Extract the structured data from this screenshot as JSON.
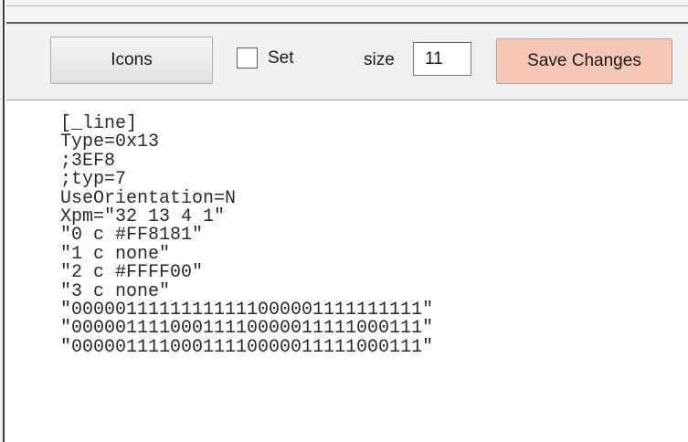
{
  "toolbar": {
    "icons_label": "Icons",
    "set_label": "Set",
    "set_checked": false,
    "size_label": "size",
    "size_value": "11",
    "save_label": "Save Changes",
    "save_color": "#f7c7b6"
  },
  "editor": {
    "lines": [
      "[_line]",
      "Type=0x13",
      ";3EF8",
      ";typ=7",
      "UseOrientation=N",
      "Xpm=\"32 13 4 1\"",
      "\"0 c #FF8181\"",
      "\"1 c none\"",
      "\"2 c #FFFF00\"",
      "\"3 c none\"",
      "\"00000111111111111000001111111111\"",
      "\"00000111100011110000011111000111\"",
      "\"00000111100011110000011111000111\""
    ]
  }
}
